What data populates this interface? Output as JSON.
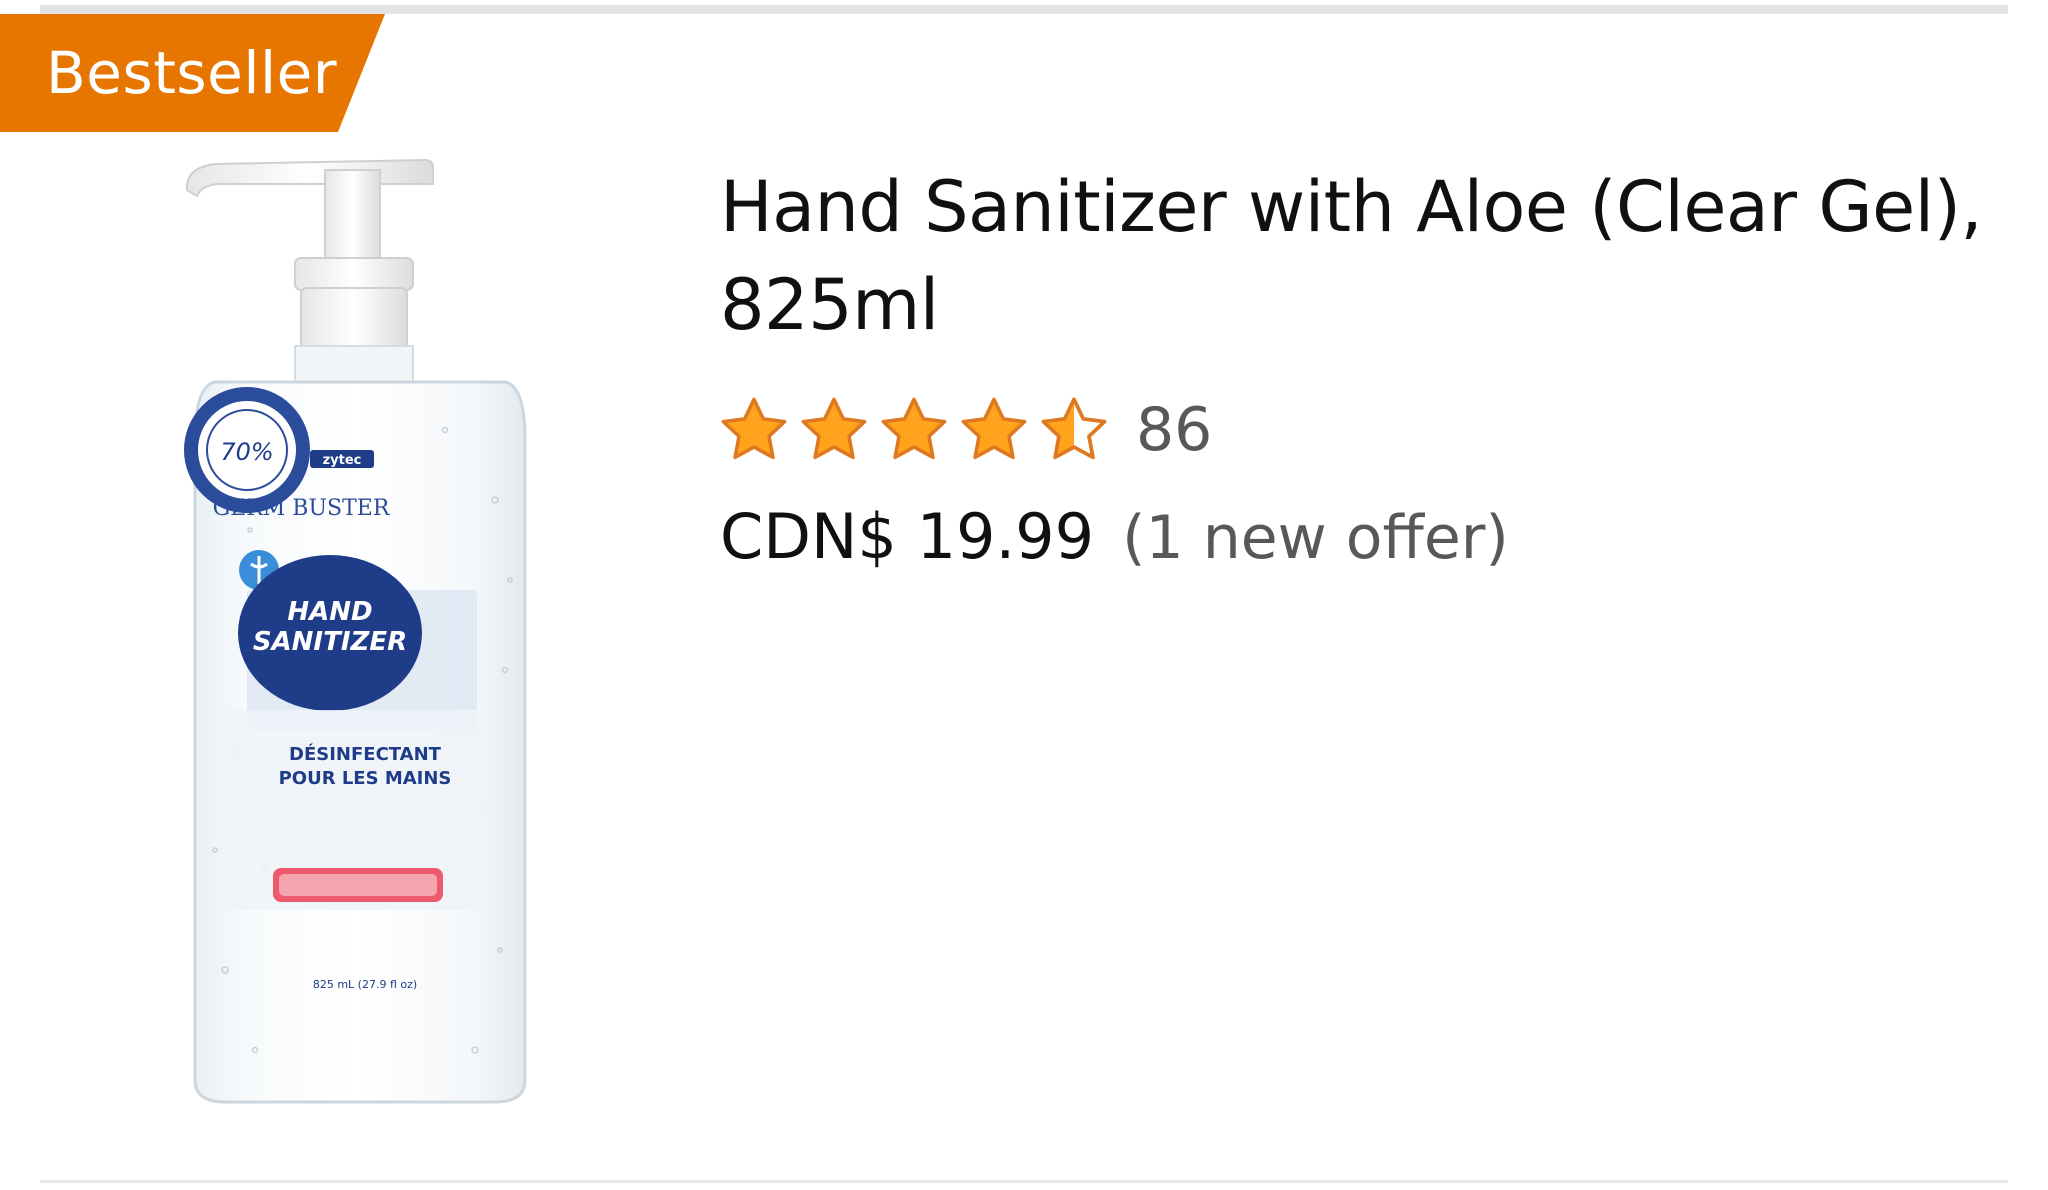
{
  "badge": {
    "label": "Bestseller",
    "color": "#e77600"
  },
  "product": {
    "image_alt": "Zytec Germ Buster Hand Sanitizer bottle with pump",
    "image_label": {
      "brand": "zytec",
      "line": "GERM BUSTER",
      "seal_percent": "70%",
      "name_line1": "HAND",
      "name_line2": "SANITIZER",
      "fr_line1": "DÉSINFECTANT",
      "fr_line2": "POUR LES MAINS",
      "volume": "825 mL (27.9 fl oz)"
    },
    "title": "Hand Sanitizer with Aloe (Clear Gel), 825ml",
    "rating": {
      "value": 4.5,
      "out_of": 5,
      "count": "86",
      "star_color": "#ffa41c"
    },
    "price": "CDN$ 19.99",
    "offer": "(1 new offer)"
  }
}
